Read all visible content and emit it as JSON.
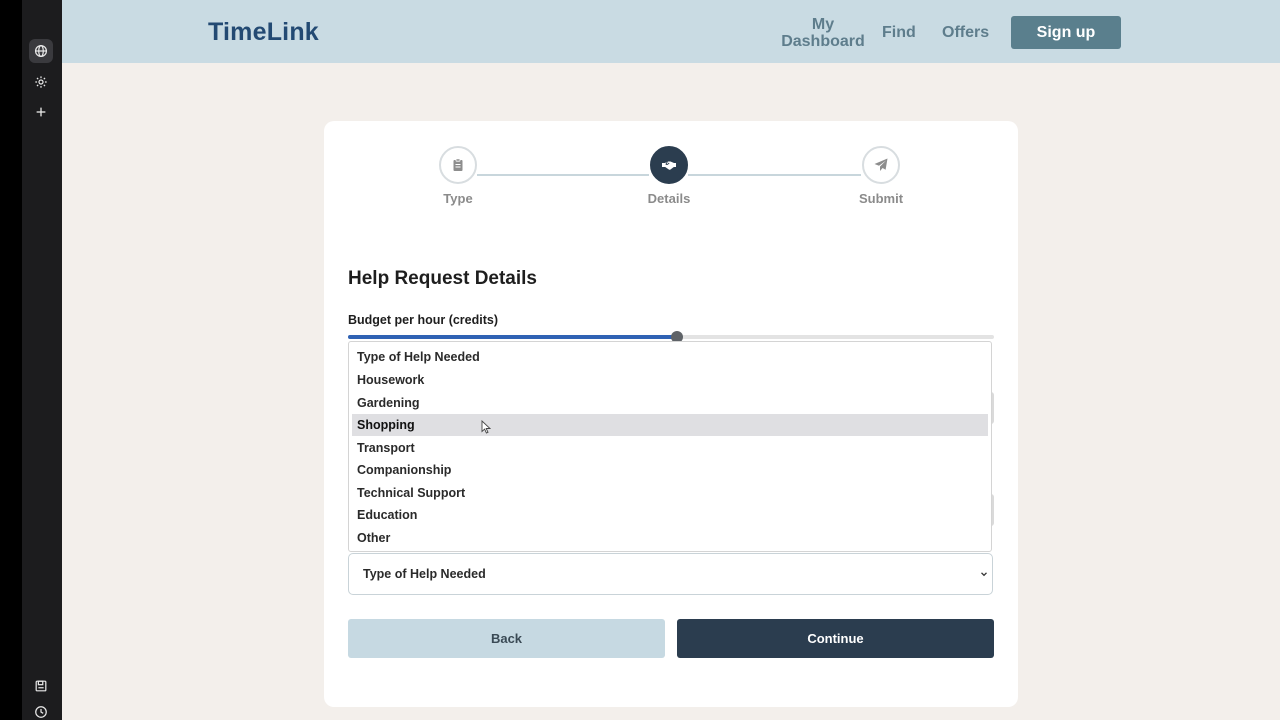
{
  "sidebar": {
    "icons": [
      "globe-icon",
      "gear-icon",
      "plus-icon",
      "save-icon",
      "clock-icon"
    ]
  },
  "header": {
    "brand": "TimeLink",
    "nav": {
      "dashboard_line1": "My",
      "dashboard_line2": "Dashboard",
      "find": "Find",
      "offers": "Offers"
    },
    "signup": "Sign up"
  },
  "stepper": {
    "steps": [
      {
        "label": "Type",
        "icon": "clipboard-icon",
        "active": false
      },
      {
        "label": "Details",
        "icon": "handshake-icon",
        "active": true
      },
      {
        "label": "Submit",
        "icon": "paper-plane-icon",
        "active": false
      }
    ]
  },
  "form": {
    "title": "Help Request Details",
    "budget_label": "Budget per hour (credits)",
    "budget_fraction": 0.51,
    "help_type": {
      "selected": "Type of Help Needed",
      "highlighted": "Shopping",
      "options": [
        "Type of Help Needed",
        "Housework",
        "Gardening",
        "Shopping",
        "Transport",
        "Companionship",
        "Technical Support",
        "Education",
        "Other"
      ]
    }
  },
  "actions": {
    "back": "Back",
    "continue": "Continue"
  },
  "colors": {
    "header_bg": "#c9dbe3",
    "brand": "#234a73",
    "primary_dark": "#2b3d4f",
    "slider_fill": "#2f62b4",
    "page_bg": "#f3efeb"
  }
}
